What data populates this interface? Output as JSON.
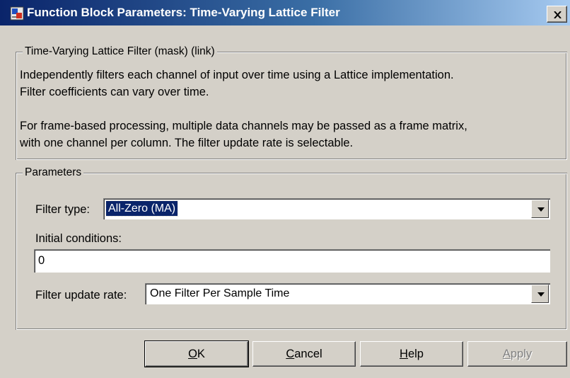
{
  "window": {
    "title": "Function Block Parameters: Time-Varying Lattice Filter"
  },
  "description": {
    "group_label": "Time-Varying Lattice Filter (mask) (link)",
    "line1": "Independently filters each channel of input over time using a Lattice implementation.",
    "line2": "Filter coefficients can vary over time.",
    "line3": "For frame-based processing, multiple data channels may be passed as a frame matrix,",
    "line4": "with one channel per column.  The filter update rate is selectable."
  },
  "parameters": {
    "group_label": "Parameters",
    "filter_type": {
      "label": "Filter type:",
      "value": "All-Zero (MA)"
    },
    "initial_conditions": {
      "label": "Initial conditions:",
      "value": "0"
    },
    "filter_update_rate": {
      "label": "Filter update rate:",
      "value": "One Filter Per Sample Time"
    }
  },
  "buttons": {
    "ok": {
      "mnemonic": "O",
      "rest": "K"
    },
    "cancel": {
      "mnemonic": "C",
      "rest": "ancel"
    },
    "help": {
      "mnemonic": "H",
      "rest": "elp"
    },
    "apply": {
      "mnemonic": "A",
      "rest": "pply"
    }
  },
  "icons": {
    "app": "simulink-block-icon",
    "close": "close-icon",
    "dropdown": "chevron-down-icon"
  }
}
